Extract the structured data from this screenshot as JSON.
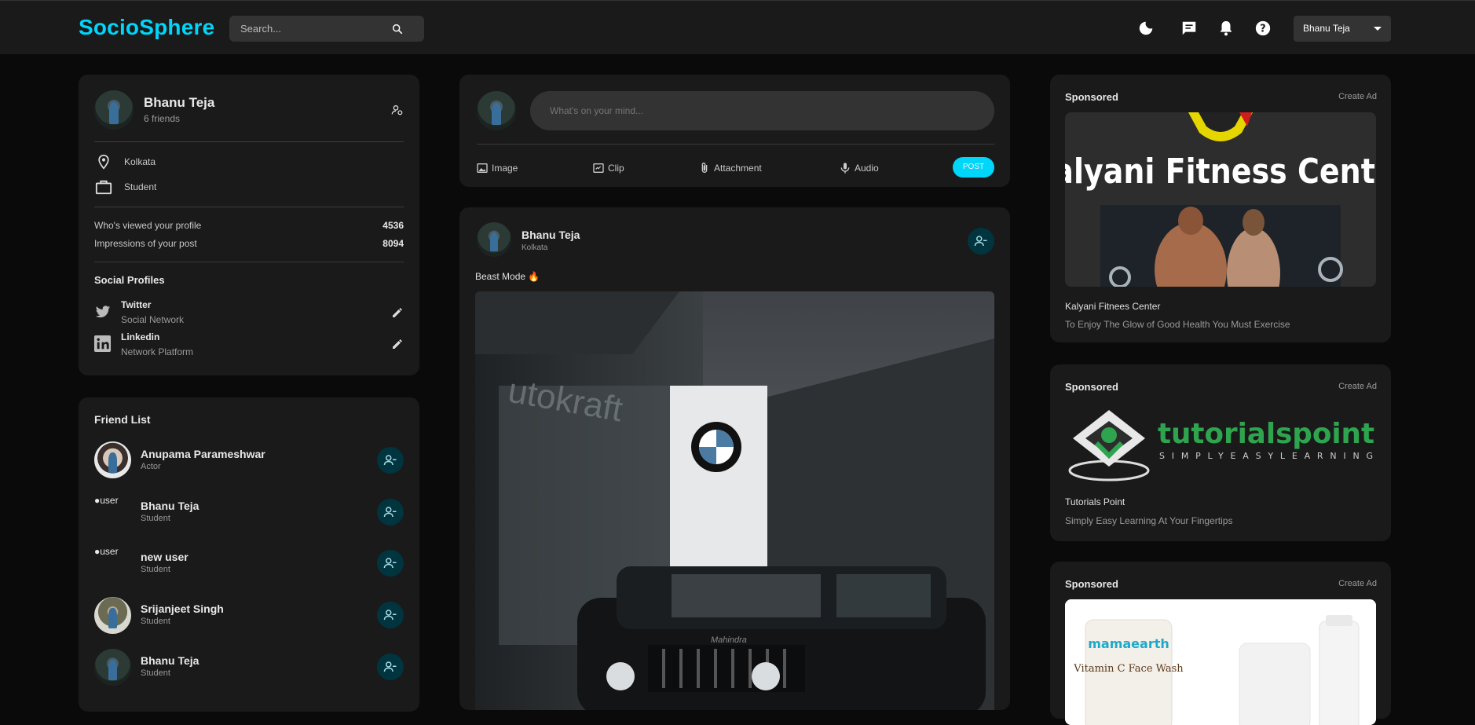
{
  "brand": "SocioSphere",
  "search": {
    "placeholder": "Search..."
  },
  "topbar": {
    "user_select": "Bhanu Teja"
  },
  "profile": {
    "name": "Bhanu Teja",
    "friends": "6 friends",
    "location": "Kolkata",
    "occupation": "Student",
    "stats": [
      {
        "label": "Who's viewed your profile",
        "value": "4536"
      },
      {
        "label": "Impressions of your post",
        "value": "8094"
      }
    ],
    "social_title": "Social Profiles",
    "social": [
      {
        "name": "Twitter",
        "sub": "Social Network"
      },
      {
        "name": "Linkedin",
        "sub": "Network Platform"
      }
    ]
  },
  "friends": {
    "title": "Friend List",
    "items": [
      {
        "name": "Anupama Parameshwar",
        "sub": "Actor",
        "img": "photo"
      },
      {
        "name": "Bhanu Teja",
        "sub": "Student",
        "img": "broken",
        "alt": "user"
      },
      {
        "name": "new user",
        "sub": "Student",
        "img": "broken",
        "alt": "user"
      },
      {
        "name": "Srijanjeet Singh",
        "sub": "Student",
        "img": "photo"
      },
      {
        "name": "Bhanu Teja",
        "sub": "Student",
        "img": "photo"
      }
    ]
  },
  "composer": {
    "placeholder": "What's on your mind...",
    "actions": [
      "Image",
      "Clip",
      "Attachment",
      "Audio"
    ],
    "post_label": "POST"
  },
  "post": {
    "author": "Bhanu Teja",
    "location": "Kolkata",
    "caption": "Beast Mode 🔥",
    "image_text": {
      "sign": "utokraft",
      "grille": "Mahindra"
    }
  },
  "ads": [
    {
      "label": "Sponsored",
      "create": "Create Ad",
      "title": "Kalyani Fitnees Center",
      "desc": "To Enjoy The Glow of Good Health You Must Exercise",
      "image_text": "Kalyani Fitness Centre"
    },
    {
      "label": "Sponsored",
      "create": "Create Ad",
      "title": "Tutorials Point",
      "desc": "Simply Easy Learning At Your Fingertips",
      "image_text": "tutorialspoint",
      "image_sub": "SIMPLYEASYLEARNING"
    },
    {
      "label": "Sponsored",
      "create": "Create Ad",
      "image_text": "mamaearth",
      "image_sub": "Vitamin C Face Wash"
    }
  ],
  "colors": {
    "accent": "#00d5fa",
    "card": "#1a1a1a",
    "bg": "#0a0a0a",
    "btn": "#00353f"
  }
}
